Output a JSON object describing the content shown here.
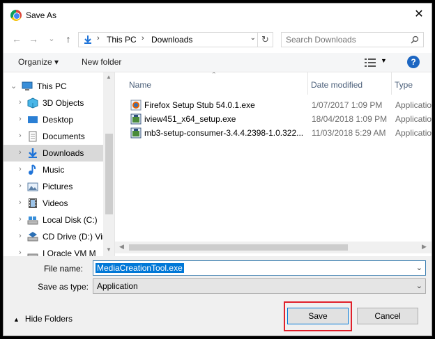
{
  "window": {
    "title": "Save As",
    "close_glyph": "✕"
  },
  "nav": {
    "back_glyph": "←",
    "forward_glyph": "→",
    "recent_glyph": "⌄",
    "up_glyph": "↑",
    "breadcrumbs": [
      "This PC",
      "Downloads"
    ],
    "breadcrumb_sep": "›",
    "dropdown_glyph": "⌄",
    "refresh_glyph": "↻",
    "search_placeholder": "Search Downloads"
  },
  "toolbar": {
    "organize_label": "Organize ▾",
    "new_folder_label": "New folder",
    "view_drop_glyph": "▼",
    "help_glyph": "?"
  },
  "sidebar": {
    "items": [
      {
        "label": "This PC",
        "icon": "computer-icon",
        "arrow": "⌄",
        "level": 0
      },
      {
        "label": "3D Objects",
        "icon": "cube-icon",
        "arrow": "›",
        "level": 1
      },
      {
        "label": "Desktop",
        "icon": "desktop-icon",
        "arrow": "›",
        "level": 1
      },
      {
        "label": "Documents",
        "icon": "document-icon",
        "arrow": "›",
        "level": 1
      },
      {
        "label": "Downloads",
        "icon": "download-icon",
        "arrow": "›",
        "level": 1,
        "selected": true
      },
      {
        "label": "Music",
        "icon": "music-icon",
        "arrow": "›",
        "level": 1
      },
      {
        "label": "Pictures",
        "icon": "picture-icon",
        "arrow": "›",
        "level": 1
      },
      {
        "label": "Videos",
        "icon": "video-icon",
        "arrow": "›",
        "level": 1
      },
      {
        "label": "Local Disk (C:)",
        "icon": "disk-icon",
        "arrow": "›",
        "level": 1
      },
      {
        "label": "CD Drive (D:) Vir",
        "icon": "cd-drive-icon",
        "arrow": "›",
        "level": 1
      },
      {
        "label": "I  Oracle VM M",
        "icon": "cd-drive-icon",
        "arrow": "›",
        "level": 1
      }
    ]
  },
  "files": {
    "columns": {
      "name": "Name",
      "date": "Date modified",
      "type": "Type"
    },
    "rows": [
      {
        "name": "Firefox Setup Stub 54.0.1.exe",
        "date": "1/07/2017 1:09 PM",
        "type": "Application",
        "icon": "firefox-installer-icon"
      },
      {
        "name": "iview451_x64_setup.exe",
        "date": "18/04/2018 1:09 PM",
        "type": "Application",
        "icon": "installer-icon"
      },
      {
        "name": "mb3-setup-consumer-3.4.4.2398-1.0.322...",
        "date": "11/03/2018 5:29 AM",
        "type": "Application",
        "icon": "installer-icon"
      }
    ]
  },
  "form": {
    "filename_label": "File name:",
    "filename_value": "MediaCreationTool.exe",
    "saveas_label": "Save as type:",
    "saveas_value": "Application",
    "dropdown_glyph": "⌄"
  },
  "footer": {
    "hide_folders_arrow": "▲",
    "hide_folders_label": "Hide Folders",
    "save_label": "Save",
    "cancel_label": "Cancel"
  },
  "colors": {
    "accent": "#0078d7",
    "highlight": "#e0202a",
    "help": "#1c66c2"
  }
}
